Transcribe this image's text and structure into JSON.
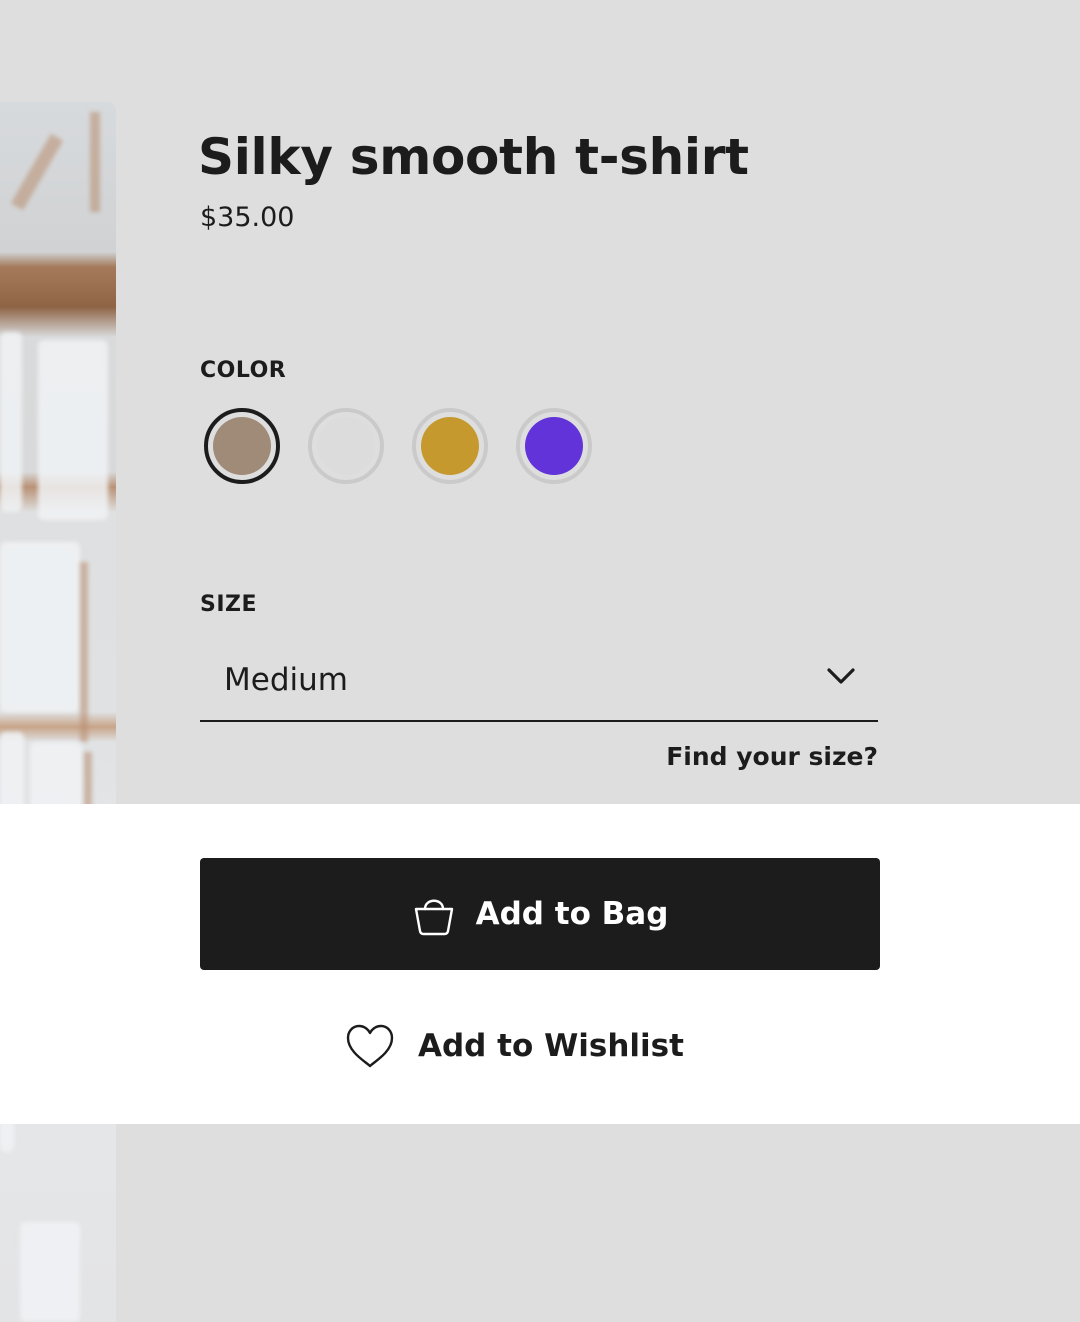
{
  "product": {
    "title": "Silky smooth t-shirt",
    "price": "$35.00"
  },
  "color": {
    "label": "COLOR",
    "selected_index": 0,
    "options": [
      {
        "name": "taupe",
        "hex": "#a08b78"
      },
      {
        "name": "light-gray",
        "hex": "#dcdcdc"
      },
      {
        "name": "mustard",
        "hex": "#c5992e"
      },
      {
        "name": "violet",
        "hex": "#6233d9"
      }
    ]
  },
  "size": {
    "label": "SIZE",
    "selected": "Medium",
    "find_size_link": "Find your size?"
  },
  "actions": {
    "add_to_bag": "Add to Bag",
    "add_to_wishlist": "Add to Wishlist"
  },
  "icons": {
    "bag": "shopping-bag-icon",
    "heart": "heart-icon",
    "chevron": "chevron-down-icon"
  }
}
